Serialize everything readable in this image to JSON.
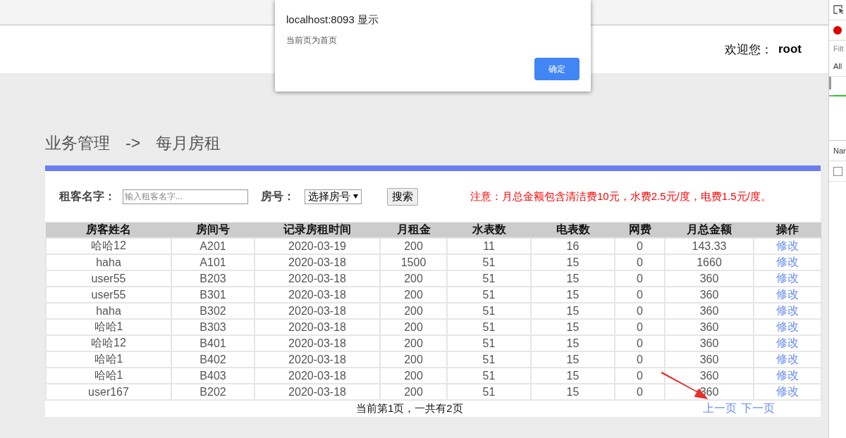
{
  "alert": {
    "title": "localhost:8093 显示",
    "message": "当前页为首页",
    "button": "确定"
  },
  "header": {
    "welcome_label": "欢迎您：",
    "user": "root"
  },
  "breadcrumb": {
    "section": "业务管理",
    "separator": "->",
    "page": "每月房租"
  },
  "filters": {
    "name_field": {
      "label": "租客名字：",
      "placeholder": "输入租客名字..."
    },
    "room_select": {
      "label": "房号：",
      "value": "选择房号"
    },
    "search_button": "搜索",
    "notice": "注意：月总金额包含清洁费10元，水费2.5元/度，电费1.5元/度。"
  },
  "table": {
    "columns": [
      "房客姓名",
      "房间号",
      "记录房租时间",
      "月租金",
      "水表数",
      "电表数",
      "网费",
      "月总金额",
      "操作"
    ],
    "rows": [
      [
        "哈哈12",
        "A201",
        "2020-03-19",
        "200",
        "11",
        "16",
        "0",
        "143.33",
        "修改"
      ],
      [
        "haha",
        "A101",
        "2020-03-18",
        "1500",
        "51",
        "15",
        "0",
        "1660",
        "修改"
      ],
      [
        "user55",
        "B203",
        "2020-03-18",
        "200",
        "51",
        "15",
        "0",
        "360",
        "修改"
      ],
      [
        "user55",
        "B301",
        "2020-03-18",
        "200",
        "51",
        "15",
        "0",
        "360",
        "修改"
      ],
      [
        "haha",
        "B302",
        "2020-03-18",
        "200",
        "51",
        "15",
        "0",
        "360",
        "修改"
      ],
      [
        "哈哈1",
        "B303",
        "2020-03-18",
        "200",
        "51",
        "15",
        "0",
        "360",
        "修改"
      ],
      [
        "哈哈12",
        "B401",
        "2020-03-18",
        "200",
        "51",
        "15",
        "0",
        "360",
        "修改"
      ],
      [
        "哈哈1",
        "B402",
        "2020-03-18",
        "200",
        "51",
        "15",
        "0",
        "360",
        "修改"
      ],
      [
        "哈哈1",
        "B403",
        "2020-03-18",
        "200",
        "51",
        "15",
        "0",
        "360",
        "修改"
      ],
      [
        "user167",
        "B202",
        "2020-03-18",
        "200",
        "51",
        "15",
        "0",
        "360",
        "修改"
      ]
    ]
  },
  "pagination": {
    "status": "当前第1页，一共有2页",
    "links": [
      "上一页",
      "下一页"
    ]
  },
  "devtools": {
    "filter_placeholder": "Filt",
    "tab": "All",
    "column": "Nar",
    "checkbox": {
      "checked": false
    }
  }
}
